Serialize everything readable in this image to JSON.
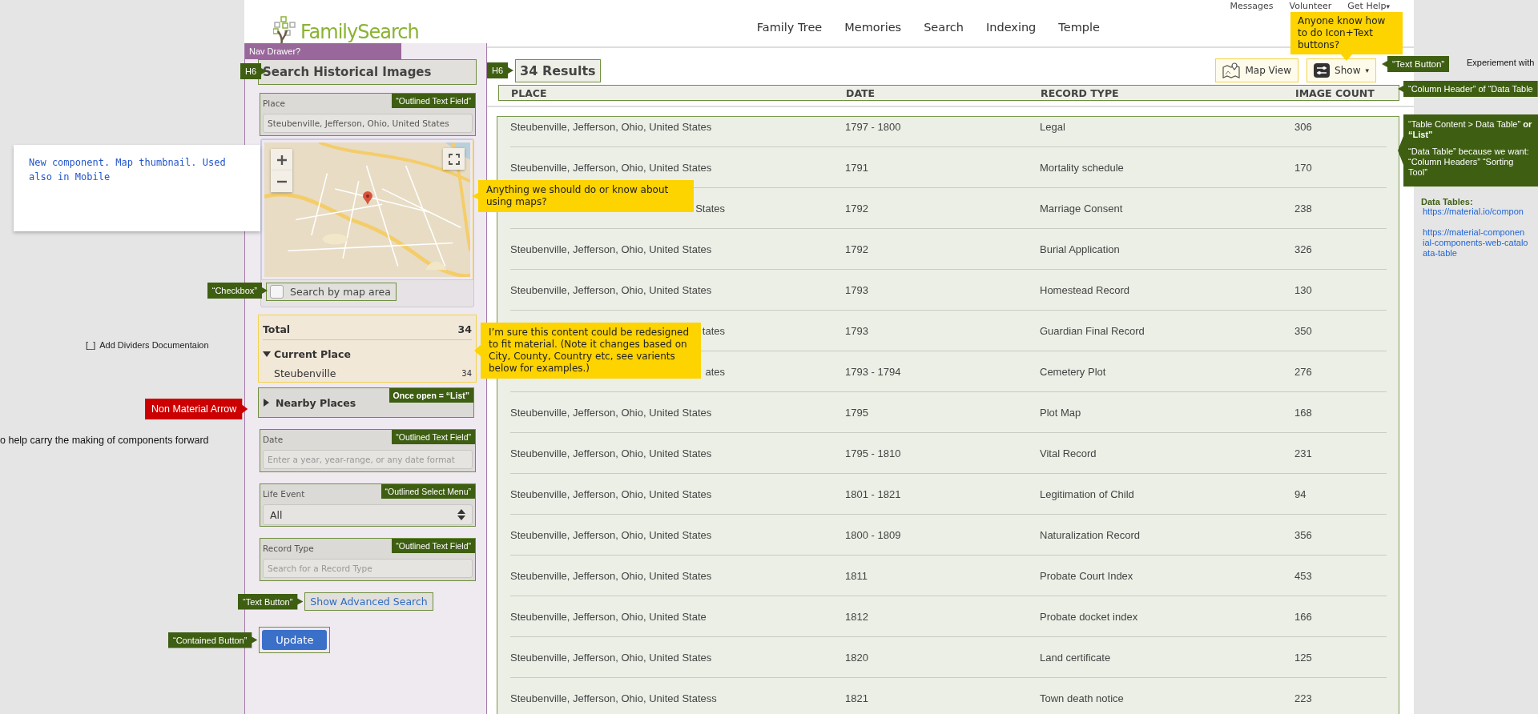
{
  "top_links": [
    {
      "label": "Messages"
    },
    {
      "label": "Volunteer"
    },
    {
      "label": "Get Help",
      "caret": "▾"
    }
  ],
  "logo": {
    "text": "FamilySearch"
  },
  "nav": [
    "Family Tree",
    "Memories",
    "Search",
    "Indexing",
    "Temple"
  ],
  "sidebar": {
    "drawer_label": "Nav Drawer?",
    "heading_tag": "H6",
    "title": "Search Historical Images",
    "place": {
      "label": "Place",
      "value": "Steubenville, Jefferson, Ohio, United States",
      "tag": "“Outlined Text Field”"
    },
    "map_checkbox": {
      "label": "Search by map area",
      "checked": false,
      "tag": "“Checkbox”"
    },
    "totals": {
      "label": "Total",
      "count": "34",
      "section": "Current Place",
      "expanded": true,
      "items": [
        {
          "label": "Steubenville",
          "count": "34"
        }
      ]
    },
    "nearby": {
      "label": "Nearby Places",
      "expanded": false,
      "tag": "Once open = “List”"
    },
    "fields": [
      {
        "kind": "text",
        "label": "Date",
        "placeholder": "Enter a year, year-range, or any date format",
        "tag": "“Outlined Text Field”"
      },
      {
        "kind": "select",
        "label": "Life Event",
        "value": "All",
        "tag": "“Outlined Select Menu”"
      },
      {
        "kind": "text",
        "label": "Record Type",
        "placeholder": "Search for a Record Type",
        "tag": "“Outlined Text Field”"
      }
    ],
    "advanced": {
      "label": "Show Advanced Search",
      "tag": "“Text Button”"
    },
    "update": {
      "label": "Update",
      "tag": "“Contained Button”"
    }
  },
  "results": {
    "heading_tag": "H6",
    "title": "34 Results",
    "buttons": [
      {
        "kind": "map",
        "label": "Map View"
      },
      {
        "kind": "show",
        "label": "Show",
        "caret": "▾"
      }
    ],
    "columns": [
      "PLACE",
      "DATE",
      "RECORD TYPE",
      "IMAGE COUNT"
    ],
    "rows": [
      {
        "place": "Steubenville, Jefferson, Ohio, United States",
        "cut": false,
        "date": "1797 - 1800",
        "type": "Legal",
        "count": "306"
      },
      {
        "place": "Steubenville, Jefferson, Ohio, United States",
        "cut": false,
        "date": "1791",
        "type": "Mortality schedule",
        "count": "170"
      },
      {
        "place": "States",
        "cut": true,
        "date": "1792",
        "type": "Marriage Consent",
        "count": "238"
      },
      {
        "place": "Steubenville, Jefferson, Ohio, United States",
        "cut": false,
        "date": "1792",
        "type": "Burial Application",
        "count": "326"
      },
      {
        "place": "Steubenville, Jefferson, Ohio, United States",
        "cut": false,
        "date": "1793",
        "type": "Homestead Record",
        "count": "130"
      },
      {
        "place": "tates",
        "cut": true,
        "date": "1793",
        "type": "Guardian Final Record",
        "count": "350"
      },
      {
        "place": "ates",
        "cut": true,
        "date": "1793 - 1794",
        "type": "Cemetery Plot",
        "count": "276"
      },
      {
        "place": "Steubenville, Jefferson, Ohio, United States",
        "cut": false,
        "date": "1795",
        "type": "Plot Map",
        "count": "168"
      },
      {
        "place": "Steubenville, Jefferson, Ohio, United States",
        "cut": false,
        "date": "1795 - 1810",
        "type": "Vital Record",
        "count": "231"
      },
      {
        "place": "Steubenville, Jefferson, Ohio, United States",
        "cut": false,
        "date": "1801 - 1821",
        "type": "Legitimation of Child",
        "count": "94"
      },
      {
        "place": "Steubenville, Jefferson, Ohio, United States",
        "cut": false,
        "date": "1800 - 1809",
        "type": "Naturalization Record",
        "count": "356"
      },
      {
        "place": "Steubenville, Jefferson, Ohio, United States",
        "cut": false,
        "date": "1811",
        "type": "Probate Court Index",
        "count": "453"
      },
      {
        "place": "Steubenville, Jefferson, Ohio, United State",
        "cut": false,
        "date": "1812",
        "type": "Probate docket index",
        "count": "166"
      },
      {
        "place": "Steubenville, Jefferson, Ohio, United States",
        "cut": false,
        "date": "1820",
        "type": "Land certificate",
        "count": "125"
      },
      {
        "place": "Steubenville, Jefferson, Ohio, United Statess",
        "cut": false,
        "date": "1821",
        "type": "Town death notice",
        "count": "223"
      }
    ]
  },
  "annotations": {
    "map_note": "New component. Map thumbnail. Used also in Mobile",
    "dividers_box": "[_]",
    "dividers_todo": "Add Dividers Documentaion",
    "carry_note": "o help carry the making of components forward",
    "arrow_alert": "Non Material Arrow",
    "map_question": "Anything we should do or know about using maps?",
    "content_note": "I’m sure this content could be redesigned to fit material. (Note it changes based on City, County, Country etc, see varients below for examples.)",
    "button_question": "Anyone know how to do Icon+Text buttons?",
    "show_tag": "“Text Button”",
    "experiment": "Experiement with",
    "header_tag": "“Column Header” of “Data Table",
    "table_tag": [
      "“Table Content > Data Table” **or “List”**",
      "“Data Table” because we want: “Column Headers” “Sorting Tool”"
    ],
    "data_tables_title": "Data Tables:",
    "data_tables_links": [
      "https://material.io/compon",
      "https://material-componen",
      "ial-components-web-catalo",
      "ata-table"
    ]
  }
}
